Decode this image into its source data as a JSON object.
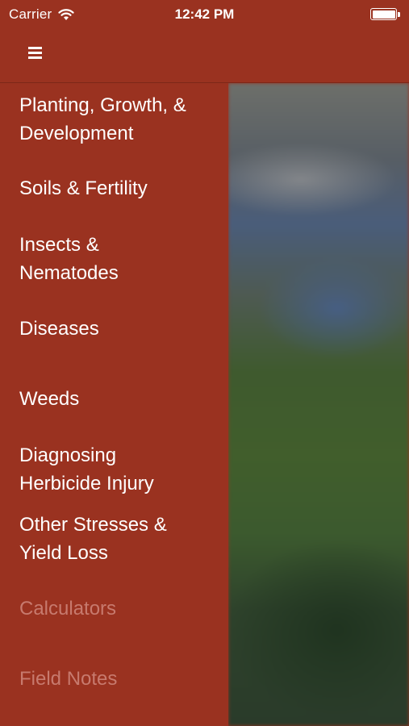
{
  "status_bar": {
    "carrier": "Carrier",
    "time": "12:42 PM",
    "wifi_icon": "wifi-icon",
    "battery_icon": "battery-full-icon"
  },
  "header": {
    "menu_icon": "hamburger-menu-icon"
  },
  "menu": {
    "items": [
      {
        "label": "Planting, Growth, & Development",
        "enabled": true
      },
      {
        "label": "Soils & Fertility",
        "enabled": true
      },
      {
        "label": "Insects & Nematodes",
        "enabled": true
      },
      {
        "label": "Diseases",
        "enabled": true
      },
      {
        "label": "Weeds",
        "enabled": true
      },
      {
        "label": "Diagnosing Herbicide Injury",
        "enabled": true
      },
      {
        "label": "Other Stresses & Yield Loss",
        "enabled": true
      },
      {
        "label": "Calculators",
        "enabled": false
      },
      {
        "label": "Field Notes",
        "enabled": false
      }
    ]
  },
  "colors": {
    "brand": "#9a3220",
    "text": "#ffffff",
    "disabled_text": "#c77a6e"
  }
}
